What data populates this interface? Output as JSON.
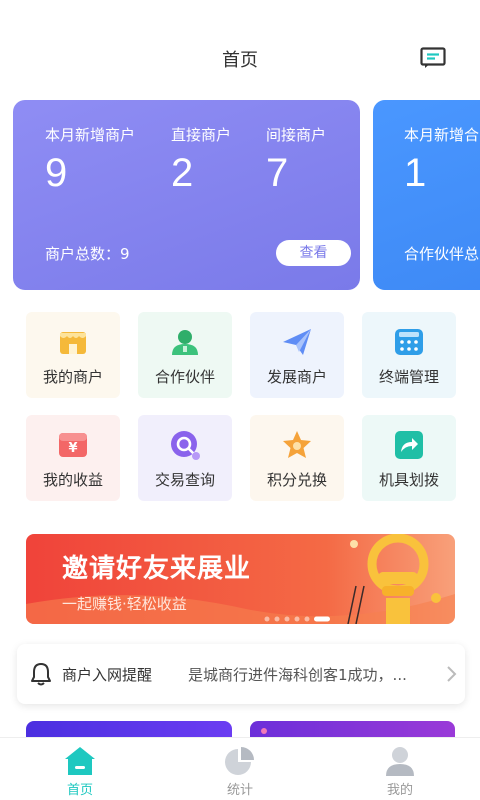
{
  "header": {
    "title": "首页",
    "message_icon": "message-icon"
  },
  "cards": [
    {
      "stats": [
        {
          "label": "本月新增商户",
          "value": "9"
        },
        {
          "label": "直接商户",
          "value": "2"
        },
        {
          "label": "间接商户",
          "value": "7"
        }
      ],
      "total": "商户总数：9",
      "view_label": "查看"
    },
    {
      "stats": [
        {
          "label": "本月新增合",
          "value": "1"
        }
      ],
      "total": "合作伙伴总"
    }
  ],
  "menu": [
    {
      "label": "我的商户",
      "icon": "store-icon",
      "bg": "#fdf8ee"
    },
    {
      "label": "合作伙伴",
      "icon": "partner-icon",
      "bg": "#eef9f3"
    },
    {
      "label": "发展商户",
      "icon": "paper-plane-icon",
      "bg": "#eef3fd"
    },
    {
      "label": "终端管理",
      "icon": "terminal-icon",
      "bg": "#edf7fb"
    },
    {
      "label": "我的收益",
      "icon": "yuan-icon",
      "bg": "#fdf0ef"
    },
    {
      "label": "交易查询",
      "icon": "search-icon",
      "bg": "#f1effc"
    },
    {
      "label": "积分兑换",
      "icon": "star-icon",
      "bg": "#fdf7ee"
    },
    {
      "label": "机具划拨",
      "icon": "share-icon",
      "bg": "#edf9f7"
    }
  ],
  "banner": {
    "title": "邀请好友来展业",
    "subtitle": "一起赚钱·轻松收益"
  },
  "notice": {
    "title": "商户入网提醒",
    "text": "是城商行进件海科创客1成功，...",
    "icon": "bell-icon"
  },
  "tabs": [
    {
      "label": "首页",
      "icon": "home-icon",
      "active": true
    },
    {
      "label": "统计",
      "icon": "pie-chart-icon",
      "active": false
    },
    {
      "label": "我的",
      "icon": "user-icon",
      "active": false
    }
  ],
  "colors": {
    "accent": "#1ec8c0",
    "card1": "#7a7ae9",
    "card2": "#3a85f2",
    "banner": "#f0433a"
  }
}
